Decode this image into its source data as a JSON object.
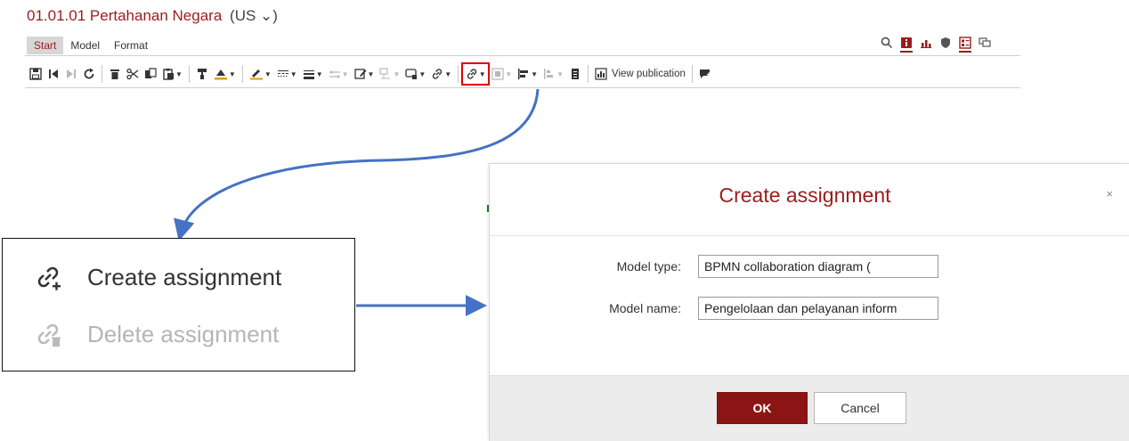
{
  "header": {
    "title": "01.01.01 Pertahanan Negara",
    "language": "(US ⌄)"
  },
  "tabs": [
    {
      "label": "Start",
      "active": true
    },
    {
      "label": "Model",
      "active": false
    },
    {
      "label": "Format",
      "active": false
    }
  ],
  "right_icons": [
    "search-icon",
    "info-icon",
    "bar-chart-icon",
    "shield-icon",
    "properties-icon",
    "chat-icon"
  ],
  "toolbar": {
    "view_publication_label": "View publication"
  },
  "zoom": {
    "create_label": "Create assignment",
    "delete_label": "Delete assignment"
  },
  "dialog": {
    "title": "Create assignment",
    "close": "×",
    "model_type_label": "Model type:",
    "model_type_value": "BPMN collaboration diagram (",
    "model_name_label": "Model name:",
    "model_name_value": "Pengelolaan dan pelayanan inform",
    "ok_label": "OK",
    "cancel_label": "Cancel"
  },
  "colors": {
    "accent": "#9b1c1c",
    "arrow": "#4472c4",
    "highlight": "#e00000",
    "ok_button": "#8b1515"
  }
}
